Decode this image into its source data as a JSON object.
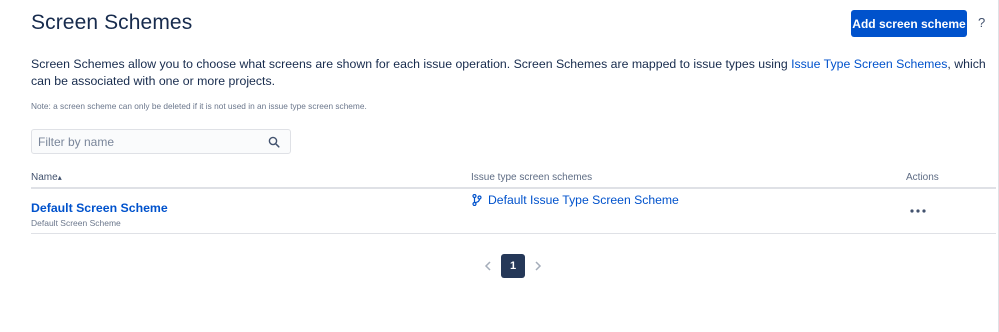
{
  "header": {
    "title": "Screen Schemes",
    "add_button_label": "Add screen scheme",
    "help_label": "?"
  },
  "description": {
    "text_before_link": "Screen Schemes allow you to choose what screens are shown for each issue operation. Screen Schemes are mapped to issue types using ",
    "link_text": "Issue Type Screen Schemes",
    "text_after_link": ", which can be associated with one or more projects."
  },
  "note": "Note: a screen scheme can only be deleted if it is not used in an issue type screen scheme.",
  "filter": {
    "placeholder": "Filter by name",
    "value": ""
  },
  "table": {
    "columns": [
      "Name",
      "Issue type screen schemes",
      "Actions"
    ],
    "sort_indicator": "▴",
    "rows": [
      {
        "name": "Default Screen Scheme",
        "description": "Default Screen Scheme",
        "issue_type_screen_scheme": "Default Issue Type Screen Scheme",
        "actions_label": "•••"
      }
    ]
  },
  "pagination": {
    "current_page": "1"
  },
  "colors": {
    "primary": "#0052cc",
    "text": "#172b4d",
    "pager_active": "#253858"
  }
}
